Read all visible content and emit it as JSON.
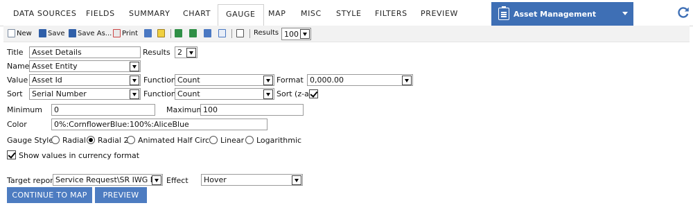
{
  "tabs": [
    "DATA SOURCES",
    "FIELDS",
    "SUMMARY",
    "CHART",
    "GAUGE",
    "MAP",
    "MISC",
    "STYLE",
    "FILTERS",
    "PREVIEW"
  ],
  "active_tab": "GAUGE",
  "app_selector": {
    "label": "Asset Management",
    "icon": "clipboard-icon"
  },
  "refresh_icon": "refresh-icon",
  "toolbar": {
    "new": "New",
    "save": "Save",
    "save_as": "Save As...",
    "print": "Print",
    "results_label": "Results",
    "results_value": "100"
  },
  "form": {
    "title_label": "Title",
    "title_value": "Asset Details",
    "results_label": "Results",
    "results_value": "2",
    "name_label": "Name",
    "name_value": "Asset Entity",
    "value_label": "Value",
    "value_value": "Asset Id",
    "function_label": "Function",
    "function_value": "Count",
    "format_label": "Format",
    "format_value": "0,000.00",
    "sort_label": "Sort",
    "sort_value": "Serial Number",
    "function2_label": "Function",
    "function2_value": "Count",
    "sort_desc_label": "Sort (z-a)",
    "sort_desc_checked": true,
    "minimum_label": "Minimum",
    "minimum_value": "0",
    "maximum_label": "Maximum",
    "maximum_value": "100",
    "color_label": "Color",
    "color_value": "0%:CornflowerBlue:100%:AliceBlue",
    "gauge_style_label": "Gauge Style",
    "gauge_styles": [
      "Radial",
      "Radial 2",
      "Animated Half Circle",
      "Linear",
      "Logarithmic"
    ],
    "gauge_style_selected": "Radial 2",
    "currency_label": "Show values in currency format",
    "currency_checked": true,
    "target_report_label": "Target report",
    "target_report_value": "Service Request\\SR IWG Drilld",
    "effect_label": "Effect",
    "effect_value": "Hover"
  },
  "buttons": {
    "continue": "CONTINUE TO MAP",
    "preview": "PREVIEW"
  },
  "colors": {
    "accent": "#3e6fb5",
    "button": "#4d7cc1"
  }
}
